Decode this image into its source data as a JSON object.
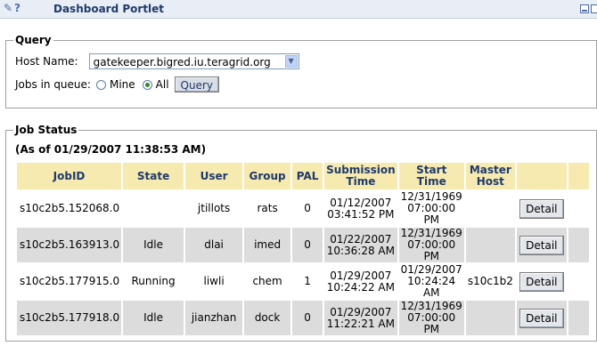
{
  "portlet": {
    "title": "Dashboard Portlet",
    "help_glyph": "?",
    "edit_icon": "pencil-icon",
    "min_icon": "minimize-icon",
    "max_icon": "maximize-icon"
  },
  "query": {
    "legend": "Query",
    "host_label": "Host Name:",
    "host_value": "gatekeeper.bigred.iu.teragrid.org",
    "jobs_label": "Jobs in queue:",
    "mine_label": "Mine",
    "all_label": "All",
    "selected": "All",
    "button": "Query"
  },
  "status": {
    "legend": "Job Status",
    "as_of": "(As of 01/29/2007 11:38:53 AM)",
    "headers": {
      "jobid": "JobID",
      "state": "State",
      "user": "User",
      "group": "Group",
      "pal": "PAL",
      "sub1": "Submission",
      "sub2": "Time",
      "start": "Start Time",
      "mh1": "Master",
      "mh2": "Host"
    },
    "rows": [
      {
        "jobid": "s10c2b5.152068.0",
        "state": "",
        "user": "jtillots",
        "group": "rats",
        "pal": "0",
        "sub_date": "01/12/2007",
        "sub_time": "03:41:52 PM",
        "start_date": "12/31/1969",
        "start_time": "07:00:00 PM",
        "host": "",
        "detail": "Detail"
      },
      {
        "jobid": "s10c2b5.163913.0",
        "state": "Idle",
        "user": "dlai",
        "group": "imed",
        "pal": "0",
        "sub_date": "01/22/2007",
        "sub_time": "10:36:28 AM",
        "start_date": "12/31/1969",
        "start_time": "07:00:00 PM",
        "host": "",
        "detail": "Detail"
      },
      {
        "jobid": "s10c2b5.177915.0",
        "state": "Running",
        "user": "liwli",
        "group": "chem",
        "pal": "1",
        "sub_date": "01/29/2007",
        "sub_time": "10:24:22 AM",
        "start_date": "01/29/2007",
        "start_time": "10:24:24 AM",
        "host": "s10c1b2",
        "detail": "Detail"
      },
      {
        "jobid": "s10c2b5.177918.0",
        "state": "Idle",
        "user": "jianzhan",
        "group": "dock",
        "pal": "0",
        "sub_date": "01/29/2007",
        "sub_time": "11:22:21 AM",
        "start_date": "12/31/1969",
        "start_time": "07:00:00 PM",
        "host": "",
        "detail": "Detail"
      }
    ]
  }
}
